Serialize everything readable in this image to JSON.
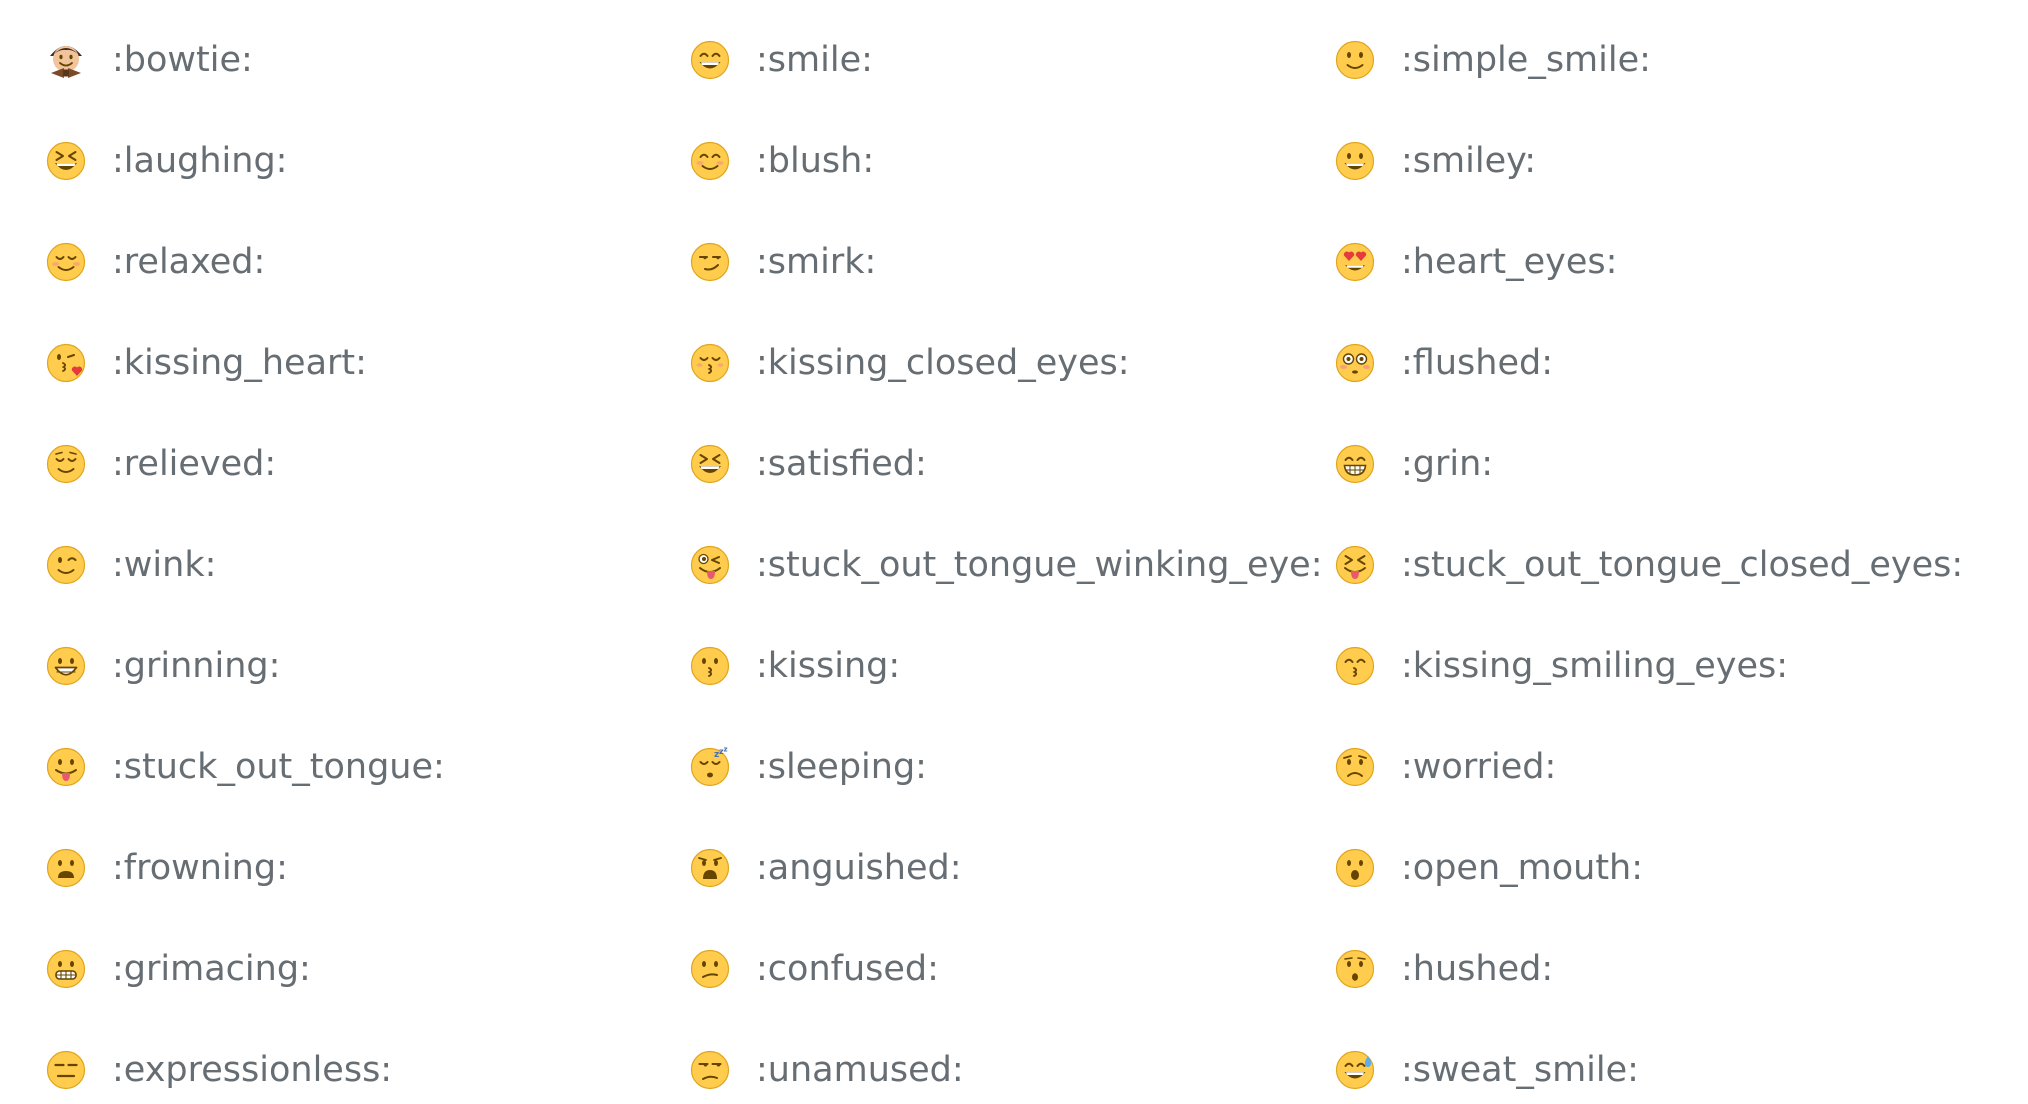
{
  "emoji_list": {
    "columns": [
      {
        "items": [
          {
            "code": ":bowtie:",
            "icon": "bowtie-icon"
          },
          {
            "code": ":laughing:",
            "icon": "laughing-icon"
          },
          {
            "code": ":relaxed:",
            "icon": "relaxed-icon"
          },
          {
            "code": ":kissing_heart:",
            "icon": "kissing-heart-icon"
          },
          {
            "code": ":relieved:",
            "icon": "relieved-icon"
          },
          {
            "code": ":wink:",
            "icon": "wink-icon"
          },
          {
            "code": ":grinning:",
            "icon": "grinning-icon"
          },
          {
            "code": ":stuck_out_tongue:",
            "icon": "stuck-out-tongue-icon"
          },
          {
            "code": ":frowning:",
            "icon": "frowning-icon"
          },
          {
            "code": ":grimacing:",
            "icon": "grimacing-icon"
          },
          {
            "code": ":expressionless:",
            "icon": "expressionless-icon"
          }
        ]
      },
      {
        "items": [
          {
            "code": ":smile:",
            "icon": "smile-icon"
          },
          {
            "code": ":blush:",
            "icon": "blush-icon"
          },
          {
            "code": ":smirk:",
            "icon": "smirk-icon"
          },
          {
            "code": ":kissing_closed_eyes:",
            "icon": "kissing-closed-eyes-icon"
          },
          {
            "code": ":satisfied:",
            "icon": "satisfied-icon"
          },
          {
            "code": ":stuck_out_tongue_winking_eye:",
            "icon": "stuck-out-tongue-winking-eye-icon"
          },
          {
            "code": ":kissing:",
            "icon": "kissing-icon"
          },
          {
            "code": ":sleeping:",
            "icon": "sleeping-icon"
          },
          {
            "code": ":anguished:",
            "icon": "anguished-icon"
          },
          {
            "code": ":confused:",
            "icon": "confused-icon"
          },
          {
            "code": ":unamused:",
            "icon": "unamused-icon"
          }
        ]
      },
      {
        "items": [
          {
            "code": ":simple_smile:",
            "icon": "simple-smile-icon"
          },
          {
            "code": ":smiley:",
            "icon": "smiley-icon"
          },
          {
            "code": ":heart_eyes:",
            "icon": "heart-eyes-icon"
          },
          {
            "code": ":flushed:",
            "icon": "flushed-icon"
          },
          {
            "code": ":grin:",
            "icon": "grin-icon"
          },
          {
            "code": ":stuck_out_tongue_closed_eyes:",
            "icon": "stuck-out-tongue-closed-eyes-icon"
          },
          {
            "code": ":kissing_smiling_eyes:",
            "icon": "kissing-smiling-eyes-icon"
          },
          {
            "code": ":worried:",
            "icon": "worried-icon"
          },
          {
            "code": ":open_mouth:",
            "icon": "open-mouth-icon"
          },
          {
            "code": ":hushed:",
            "icon": "hushed-icon"
          },
          {
            "code": ":sweat_smile:",
            "icon": "sweat-smile-icon"
          }
        ]
      }
    ]
  },
  "colors": {
    "text": "#666d73",
    "face": "#ffcc4d",
    "face_outline": "#e1a51d",
    "feature": "#664500",
    "tongue": "#e85a6b",
    "heart": "#e53b3b",
    "blush": "#f6a07a",
    "sweat": "#5dadec",
    "bowtie": "#7a4b28",
    "skin": "#f2c49b",
    "hair": "#3c2a1e"
  }
}
